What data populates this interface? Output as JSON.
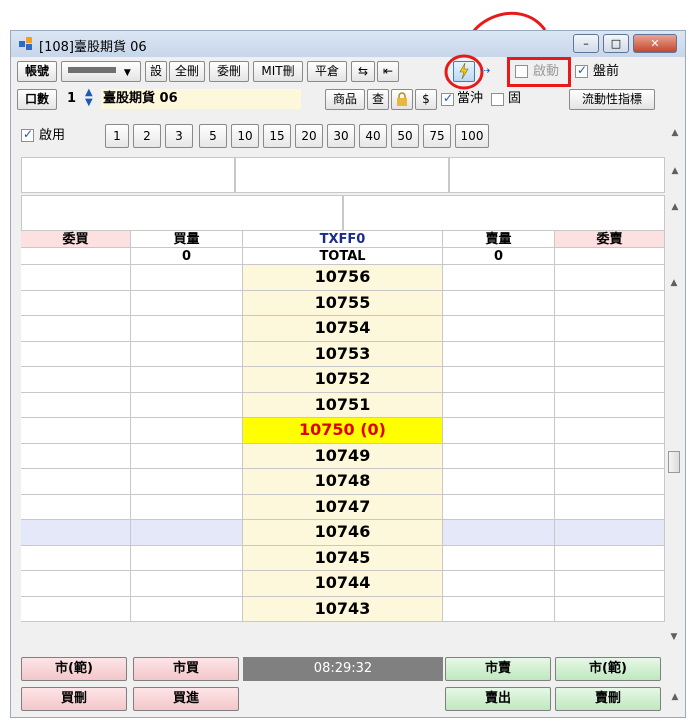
{
  "window": {
    "title": "[108]臺股期貨 06"
  },
  "toolbar1": {
    "account_label": "帳號",
    "set_label": "設",
    "delete_all_label": "全刪",
    "order_delete_label": "委刪",
    "mit_delete_label": "MIT刪",
    "close_position_label": "平倉",
    "enable_label": "啟動",
    "pre_market_label": "盤前"
  },
  "toolbar2": {
    "qty_label": "口數",
    "qty_value": "1",
    "product_name": "臺股期貨 06",
    "commodity_label": "商品",
    "query_label": "查",
    "dollar_label": "$",
    "day_trade_label": "當沖",
    "fixed_label": "固",
    "liquidity_label": "流動性指標"
  },
  "quick": {
    "enable_label": "啟用",
    "qty_buttons": [
      "1",
      "2",
      "3",
      "5",
      "10",
      "15",
      "20",
      "30",
      "40",
      "50",
      "75",
      "100"
    ]
  },
  "ladder": {
    "headers": {
      "order_buy": "委買",
      "buy_qty": "買量",
      "symbol": "TXFF0",
      "sell_qty": "賣量",
      "order_sell": "委賣"
    },
    "totals": {
      "buy_qty": "0",
      "label": "TOTAL",
      "sell_qty": "0"
    },
    "prices": [
      "10756",
      "10755",
      "10754",
      "10753",
      "10752",
      "10751",
      "10750 (0)",
      "10749",
      "10748",
      "10747",
      "10746",
      "10745",
      "10744",
      "10743"
    ],
    "current_price_index": 6,
    "highlight_row_index": 10
  },
  "footer": {
    "market_range_buy": "市(範)",
    "market_buy": "市買",
    "time": "08:29:32",
    "market_sell": "市賣",
    "market_range_sell": "市(範)",
    "buy_cancel": "買刪",
    "buy_in": "買進",
    "sell_out": "賣出",
    "sell_cancel": "賣刪"
  },
  "colors": {
    "annotation": "#e8191b",
    "current_price_bg": "#ffff00",
    "current_price_text": "#e00000"
  }
}
